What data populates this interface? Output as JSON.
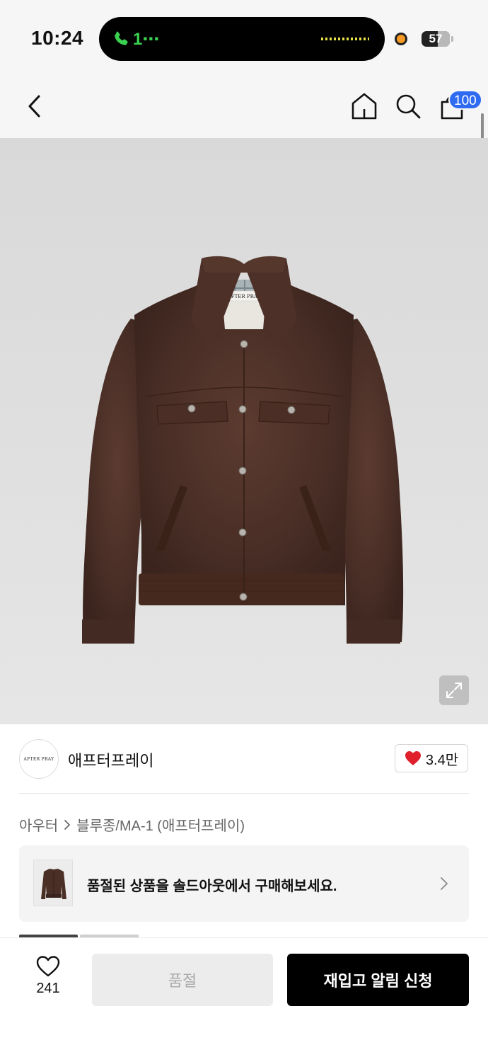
{
  "status_bar": {
    "time": "10:24",
    "call_text": "1⋯",
    "battery_level": "57",
    "battery_fraction": 0.57
  },
  "header": {
    "back_icon": "chevron-left-icon",
    "home_icon": "home-icon",
    "search_icon": "search-icon",
    "cart_icon": "cart-icon",
    "cart_badge": "100",
    "accent_color": "#2f6bf0"
  },
  "product": {
    "image_alt": "brown suede trucker jacket",
    "label_text": "AFTER PRAY",
    "expand_icon": "expand-icon"
  },
  "brand": {
    "logo_text": "AFTER PRAY",
    "name": "애프터프레이",
    "like_count": "3.4만",
    "like_color": "#e0202b"
  },
  "breadcrumb": {
    "category": "아우터",
    "subcategory": "블루종/MA-1 (애프터프레이)"
  },
  "soldout_banner": {
    "text": "품절된 상품을 솔드아웃에서 구매해보세요."
  },
  "bottom_bar": {
    "wish_count": "241",
    "soldout_label": "품절",
    "restock_label": "재입고 알림 신청"
  }
}
